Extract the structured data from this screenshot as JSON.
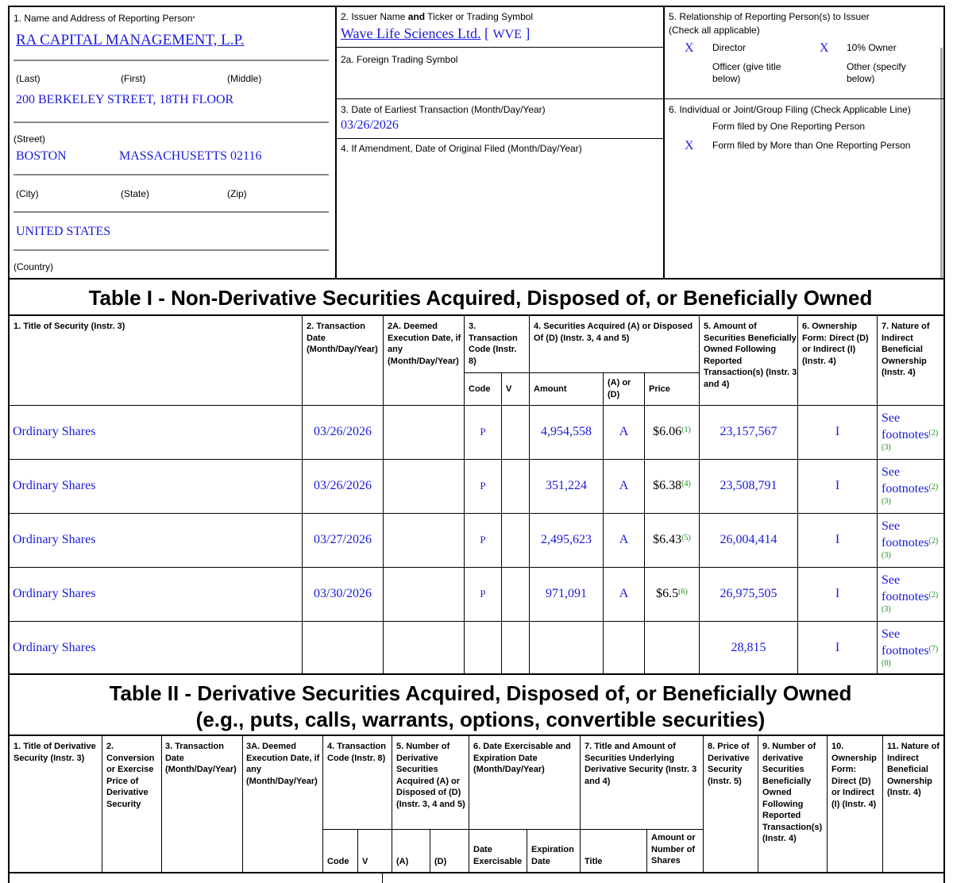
{
  "reporting_person": {
    "label": "1. Name and Address of Reporting Person",
    "label_star": "*",
    "name": "RA CAPITAL MANAGEMENT, L.P.",
    "last_label": "(Last)",
    "first_label": "(First)",
    "middle_label": "(Middle)",
    "street": "200 BERKELEY STREET, 18TH FLOOR",
    "street_label": "(Street)",
    "city": "BOSTON",
    "state_zip": "MASSACHUSETTS 02116",
    "city_label": "(City)",
    "state_label": "(State)",
    "zip_label": "(Zip)",
    "country": "UNITED STATES",
    "country_label": "(Country)"
  },
  "issuer": {
    "label_pre": "2. Issuer Name ",
    "label_and": "and",
    "label_post": " Ticker or Trading Symbol",
    "name": "Wave Life Sciences Ltd.",
    "bracket_open": "[",
    "ticker": "WVE",
    "bracket_close": "]",
    "foreign_label": "2a. Foreign Trading Symbol",
    "date_label": "3. Date of Earliest Transaction (Month/Day/Year)",
    "date": "03/26/2026",
    "amend_label": "4. If Amendment, Date of Original Filed (Month/Day/Year)"
  },
  "relationship": {
    "label": "5. Relationship of Reporting Person(s) to Issuer",
    "sublabel": "(Check all applicable)",
    "director_mark": "X",
    "director": "Director",
    "owner_mark": "X",
    "owner": "10% Owner",
    "officer": "Officer (give title below)",
    "other": "Other (specify below)"
  },
  "filing": {
    "label": "6. Individual or Joint/Group Filing (Check Applicable Line)",
    "one": "Form filed by One Reporting Person",
    "more_mark": "X",
    "more": "Form filed by More than One Reporting Person"
  },
  "table1": {
    "title": "Table I - Non-Derivative Securities Acquired, Disposed of, or Beneficially Owned",
    "headers": {
      "c1": "1. Title of Security (Instr. 3)",
      "c2": "2. Transaction Date (Month/Day/Year)",
      "c2a": "2A. Deemed Execution Date, if any (Month/Day/Year)",
      "c3": "3. Transaction Code (Instr. 8)",
      "c4": "4. Securities Acquired (A) or Disposed Of (D) (Instr. 3, 4 and 5)",
      "c5": "5. Amount of Securities Beneficially Owned Following Reported Transaction(s) (Instr. 3 and 4)",
      "c6": "6. Ownership Form: Direct (D) or Indirect (I) (Instr. 4)",
      "c7": "7. Nature of Indirect Beneficial Ownership (Instr. 4)",
      "code": "Code",
      "v": "V",
      "amount": "Amount",
      "aord": "(A) or (D)",
      "price": "Price"
    },
    "rows": [
      {
        "title": "Ordinary Shares",
        "date": "03/26/2026",
        "code": "P",
        "amount": "4,954,558",
        "aord": "A",
        "price": "$6.06",
        "price_fn": "(1)",
        "owned": "23,157,567",
        "form": "I",
        "nature_1": "See",
        "nature_2": "footnotes",
        "nature_fn1": "(2)",
        "nature_fn2": "(3)"
      },
      {
        "title": "Ordinary Shares",
        "date": "03/26/2026",
        "code": "P",
        "amount": "351,224",
        "aord": "A",
        "price": "$6.38",
        "price_fn": "(4)",
        "owned": "23,508,791",
        "form": "I",
        "nature_1": "See",
        "nature_2": "footnotes",
        "nature_fn1": "(2)",
        "nature_fn2": "(3)"
      },
      {
        "title": "Ordinary Shares",
        "date": "03/27/2026",
        "code": "P",
        "amount": "2,495,623",
        "aord": "A",
        "price": "$6.43",
        "price_fn": "(5)",
        "owned": "26,004,414",
        "form": "I",
        "nature_1": "See",
        "nature_2": "footnotes",
        "nature_fn1": "(2)",
        "nature_fn2": "(3)"
      },
      {
        "title": "Ordinary Shares",
        "date": "03/30/2026",
        "code": "P",
        "amount": "971,091",
        "aord": "A",
        "price": "$6.5",
        "price_fn": "(6)",
        "owned": "26,975,505",
        "form": "I",
        "nature_1": "See",
        "nature_2": "footnotes",
        "nature_fn1": "(2)",
        "nature_fn2": "(3)"
      },
      {
        "title": "Ordinary Shares",
        "date": "",
        "code": "",
        "amount": "",
        "aord": "",
        "price": "",
        "price_fn": "",
        "owned": "28,815",
        "form": "I",
        "nature_1": "See",
        "nature_2": "footnotes",
        "nature_fn1": "(7)",
        "nature_fn2": "(8)"
      }
    ]
  },
  "table2": {
    "title_1": "Table II - Derivative Securities Acquired, Disposed of, or Beneficially Owned",
    "title_2": "(e.g., puts, calls, warrants, options, convertible securities)",
    "headers": {
      "c1": "1. Title of Derivative Security (Instr. 3)",
      "c2": "2. Conversion or Exercise Price of Derivative Security",
      "c3": "3. Transaction Date (Month/Day/Year)",
      "c3a": "3A. Deemed Execution Date, if any (Month/Day/Year)",
      "c4": "4. Transaction Code (Instr. 8)",
      "c5": "5. Number of Derivative Securities Acquired (A) or Disposed of (D) (Instr. 3, 4 and 5)",
      "c6": "6. Date Exercisable and Expiration Date (Month/Day/Year)",
      "c7": "7. Title and Amount of Securities Underlying Derivative Security (Instr. 3 and 4)",
      "c8": "8. Price of Derivative Security (Instr. 5)",
      "c9": "9. Number of derivative Securities Beneficially Owned Following Reported Transaction(s) (Instr. 4)",
      "c10": "10. Ownership Form: Direct (D) or Indirect (I) (Instr. 4)",
      "c11": "11. Nature of Indirect Beneficial Ownership (Instr. 4)",
      "code": "Code",
      "v": "V",
      "a": "(A)",
      "d": "(D)",
      "date_ex": "Date Exercisable",
      "exp": "Expiration Date",
      "title": "Title",
      "amt": "Amount or Number of Shares"
    }
  }
}
